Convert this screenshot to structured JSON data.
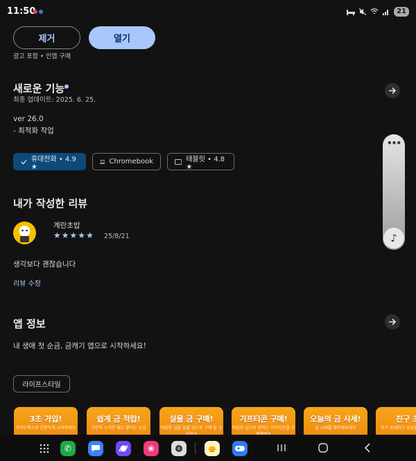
{
  "status_bar": {
    "time": "11:50",
    "battery": "21"
  },
  "actions": {
    "remove_label": "제거",
    "open_label": "열기",
    "ad_note": "광고 포함 • 인앱 구매"
  },
  "whats_new": {
    "title": "새로운 기능",
    "updated": "최종 업데이트: 2025. 6. 25.",
    "version": "ver 26.0",
    "notes": "- 최적화 작업"
  },
  "chips": [
    {
      "label": "휴대전화 • 4.9 ★",
      "selected": true,
      "icon": "check-icon"
    },
    {
      "label": "Chromebook",
      "selected": false,
      "icon": "laptop-icon"
    },
    {
      "label": "태블릿 • 4.8 ★",
      "selected": false,
      "icon": "tablet-icon"
    }
  ],
  "my_review": {
    "title": "내가 작성한 리뷰",
    "reviewer": "계란초밥",
    "rating": 5,
    "date": "25/8/21",
    "text": "생각보다 괜찮습니다",
    "edit_label": "리뷰 수정"
  },
  "app_info": {
    "title": "앱 정보",
    "description": "내 생애 첫 순금, 금캐기 앱으로 시작하세요!",
    "category": "라이프스타일"
  },
  "screenshots": [
    {
      "title": "3초 가입!",
      "subtitle": "카카오톡으로 간편하게 시작하세요"
    },
    {
      "title": "쉽게 금 적립!",
      "subtitle": "가만히 누가만 해도 쌓이는 순금"
    },
    {
      "title": "실물 금 구매!",
      "subtitle": "적립한 금을 실물 금으로 구매 할 수 있어요"
    },
    {
      "title": "기프티콘 구매!",
      "subtitle": "적립한 금으로 원하는 기프티콘을 구매해봐요"
    },
    {
      "title": "오늘의 금 시세!",
      "subtitle": "금 시세를 확인해보세요"
    },
    {
      "title": "친구 초",
      "subtitle": "친구 초대하고 보상을 받으세요"
    }
  ],
  "colors": {
    "accent": "#a8c7fa",
    "background": "#121212",
    "selected_chip": "#0d4a7a",
    "screenshot_orange": "#f39a15"
  }
}
